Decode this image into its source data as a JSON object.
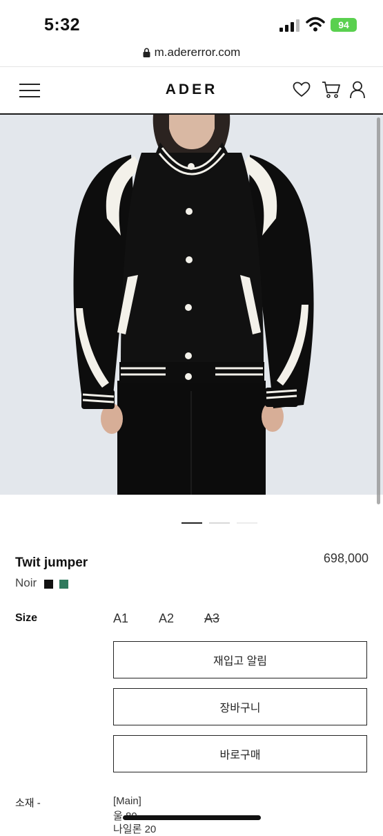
{
  "status_bar": {
    "time": "5:32",
    "battery": "94"
  },
  "browser": {
    "url": "m.adererror.com"
  },
  "nav": {
    "logo": "ADER"
  },
  "icons": [
    "menu-icon",
    "heart-icon",
    "cart-icon",
    "user-icon",
    "lock-icon"
  ],
  "product": {
    "name": "Twit jumper",
    "price": "698,000",
    "color_name": "Noir",
    "swatches": [
      "#111111",
      "#2f7a5d"
    ]
  },
  "size": {
    "label": "Size",
    "options": [
      {
        "label": "A1",
        "sold_out": false
      },
      {
        "label": "A2",
        "sold_out": false
      },
      {
        "label": "A3",
        "sold_out": true
      }
    ]
  },
  "actions": {
    "restock": "재입고 알림",
    "cart": "장바구니",
    "buy": "바로구매"
  },
  "carousel": {
    "slides": 3,
    "active": 1
  },
  "material": {
    "label": "소재 -",
    "lines": [
      "[Main]",
      "울 80",
      "나일론 20"
    ]
  },
  "colors": {
    "brand": "#111111",
    "battery": "#5ad04f",
    "hero_bg": "#e3e7ec"
  }
}
